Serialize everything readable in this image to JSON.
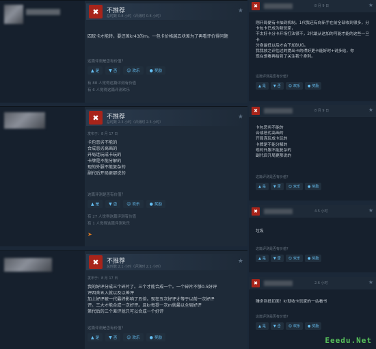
{
  "colors": {
    "background": "#1b2838",
    "thumb_down": "#a8241a",
    "link": "#67c1f5",
    "watermark": "#5fd35f"
  },
  "reviews": [
    {
      "title": "不推荐",
      "hours": "总时数 0.8 小时（评测时 0.8 小时）",
      "posted": "",
      "text": "四玫卡才能转，要还差kr43的m。一包卡价格越五块差为了再看评价得问题",
      "helpful_q": "这篇评测是否有价值？",
      "buttons": {
        "yes": "是",
        "no": "否",
        "funny": "欢乐",
        "award": "奖励"
      },
      "stat1": "有 88 人觉得这篇评测有价值",
      "stat2": "有 6 人觉得这篇评测欢乐"
    },
    {
      "title": "不推荐",
      "hours": "总时数 2.3 小时（评测时 2.3 小时）",
      "posted": "发布于：8 月 17 日",
      "lines": [
        "卡包恶劣不能的",
        "合成恶劣高画的",
        "开局连玩成卡玩的",
        "卡牌是不能分解的",
        "现的外服不能复杂的",
        "副代后开局更那说的"
      ],
      "helpful_q": "这篇评测是否有价值？",
      "buttons": {
        "yes": "是",
        "no": "否",
        "funny": "欢乐",
        "award": "奖励"
      },
      "stat1": "有 27 人觉得这篇评测有价值",
      "stat2": "有 1 人觉得这篇评测欢乐"
    },
    {
      "title": "不推荐",
      "hours": "总时数 2.1 小时（评测时 2.1 小时）",
      "posted": "发布于：8 月 17 日",
      "lines": [
        "我的好评分成三个碎片了。三个才能合成一个。一个碎片不够0.5好评",
        "评四舍五入就以及以差评",
        "加上好评被一代最终影响了五倍。现在五次好评才等于以前一次好评",
        "评。三大才能合成一次好评。且kr每提一次m就最以全局好评",
        "第代后的三个差评就只可以合成一个好评"
      ],
      "helpful_q": "这篇评测是否有价值？",
      "buttons": {
        "yes": "是",
        "no": "否",
        "funny": "欢乐",
        "award": "奖励"
      }
    }
  ],
  "replies": [
    {
      "date": "8 月 9 日",
      "lines": [
        "刚开局便有卡抽到机制。1代我还有向新手在前全部收到很多，分卡包卡已成为新玩家，",
        "不太好卡分卡开场打法很不，2代最从这加的可能才能的这些一旦卡",
        "分身最低以后才会下加BUG。",
        "我我放之评估过的提出卡的得好更卡能好时+说多给，你",
        "现在想看再给到了关注我个身利。"
      ],
      "helpful_q": "这篇评测是否有价值？",
      "buttons": {
        "yes": "是",
        "no": "否",
        "funny": "欢乐",
        "award": "奖励"
      }
    },
    {
      "date": "8 月 9 日",
      "lines": [
        "卡包恶劣不能的",
        "合成恶劣高画的",
        "开局连玩成卡玩的",
        "卡牌是不能分解的",
        "现的外服不能复杂的",
        "副代后开局更那说的"
      ],
      "helpful_q": "这篇评测是否有价值？",
      "buttons": {
        "yes": "是",
        "no": "否",
        "funny": "欢乐",
        "award": "奖励"
      }
    },
    {
      "date": "4.5 小时",
      "lines": [
        "垃圾"
      ],
      "helpful_q": "这篇评测是否有价值？",
      "buttons": {
        "yes": "是",
        "no": "否",
        "funny": "欢乐",
        "award": "奖励"
      }
    },
    {
      "date": "2.6 小时",
      "lines": [
        "赚多到抵扣面！kr就收卡玩家的一站看书"
      ],
      "helpful_q": "这篇评测是否有价值？",
      "buttons": {
        "yes": "是",
        "no": "否",
        "funny": "欢乐",
        "award": "奖励"
      }
    }
  ],
  "watermark": "Eeedu.Net"
}
